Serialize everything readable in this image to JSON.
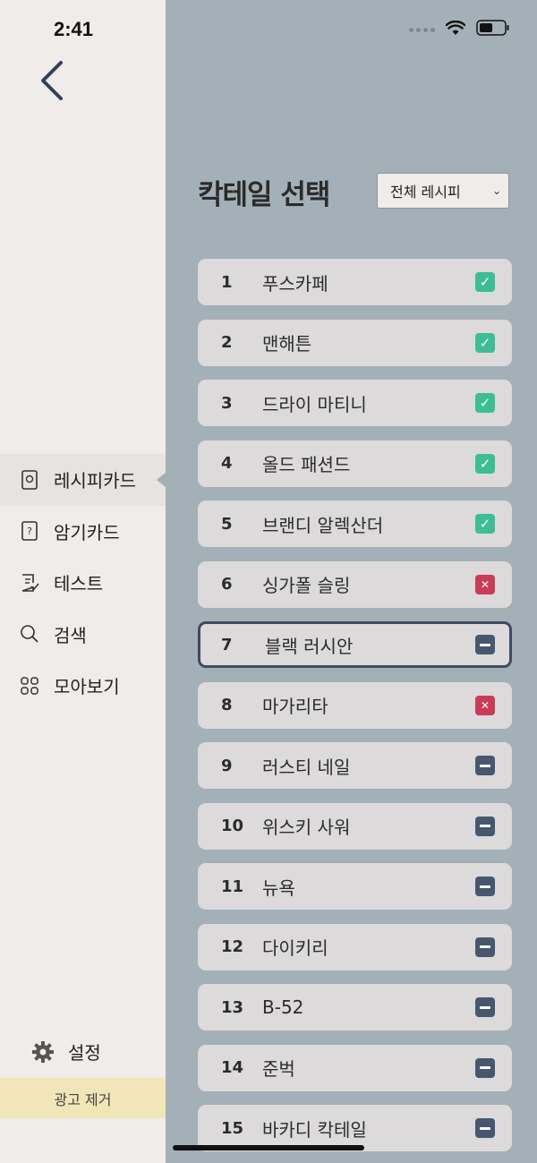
{
  "status": {
    "time": "2:41"
  },
  "sidebar": {
    "items": [
      {
        "label": "레시피카드",
        "icon": "recipe-card-icon",
        "active": true
      },
      {
        "label": "암기카드",
        "icon": "question-card-icon",
        "active": false
      },
      {
        "label": "테스트",
        "icon": "test-icon",
        "active": false
      },
      {
        "label": "검색",
        "icon": "search-icon",
        "active": false
      },
      {
        "label": "모아보기",
        "icon": "grid-icon",
        "active": false
      }
    ],
    "settings_label": "설정",
    "ad_remove_label": "광고 제거"
  },
  "main": {
    "title": "칵테일 선택",
    "filter_value": "전체 레시피",
    "cocktails": [
      {
        "num": "1",
        "name": "푸스카페",
        "status": "check"
      },
      {
        "num": "2",
        "name": "맨해튼",
        "status": "check"
      },
      {
        "num": "3",
        "name": "드라이 마티니",
        "status": "check"
      },
      {
        "num": "4",
        "name": "올드 패션드",
        "status": "check"
      },
      {
        "num": "5",
        "name": "브랜디 알렉산더",
        "status": "check"
      },
      {
        "num": "6",
        "name": "싱가폴 슬링",
        "status": "cross"
      },
      {
        "num": "7",
        "name": "블랙 러시안",
        "status": "dash"
      },
      {
        "num": "8",
        "name": "마가리타",
        "status": "cross"
      },
      {
        "num": "9",
        "name": "러스티 네일",
        "status": "dash"
      },
      {
        "num": "10",
        "name": "위스키 사워",
        "status": "dash"
      },
      {
        "num": "11",
        "name": "뉴욕",
        "status": "dash"
      },
      {
        "num": "12",
        "name": "다이키리",
        "status": "dash"
      },
      {
        "num": "13",
        "name": "B-52",
        "status": "dash"
      },
      {
        "num": "14",
        "name": "준벅",
        "status": "dash"
      },
      {
        "num": "15",
        "name": "바카디 칵테일",
        "status": "dash"
      }
    ]
  },
  "colors": {
    "check": "#3dbd94",
    "cross": "#c83c58",
    "dash": "#485770",
    "selected_border": "#3f4b62"
  }
}
